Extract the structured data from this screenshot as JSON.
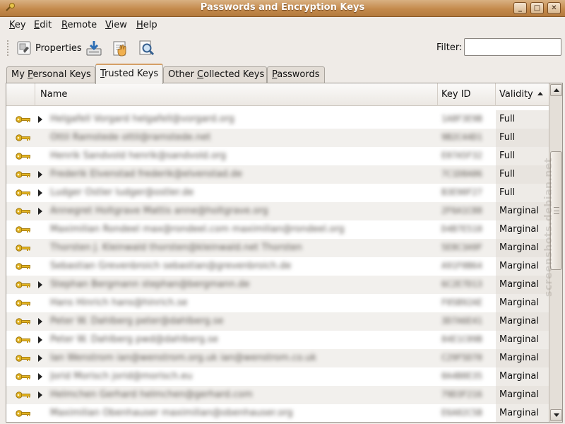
{
  "window": {
    "title": "Passwords and Encryption Keys",
    "controls": [
      "_",
      "□",
      "✕"
    ]
  },
  "menubar": {
    "items": [
      {
        "pre": "",
        "u": "K",
        "post": "ey"
      },
      {
        "pre": "",
        "u": "E",
        "post": "dit"
      },
      {
        "pre": "",
        "u": "R",
        "post": "emote"
      },
      {
        "pre": "",
        "u": "V",
        "post": "iew"
      },
      {
        "pre": "",
        "u": "H",
        "post": "elp"
      }
    ]
  },
  "toolbar": {
    "properties_label": "Properties",
    "icons": [
      "properties-icon",
      "import-icon",
      "sign-icon",
      "search-remote-icon"
    ],
    "filter_label": "Filter:",
    "filter_value": ""
  },
  "tabs": [
    {
      "pre": "My ",
      "u": "P",
      "post": "ersonal Keys",
      "active": false
    },
    {
      "pre": "",
      "u": "T",
      "post": "rusted Keys",
      "active": true
    },
    {
      "pre": "Other ",
      "u": "C",
      "post": "ollected Keys",
      "active": false
    },
    {
      "pre": "",
      "u": "P",
      "post": "asswords",
      "active": false
    }
  ],
  "table": {
    "columns": {
      "name": "Name",
      "keyid": "Key ID",
      "validity": "Validity"
    },
    "sort": "validity-ascending",
    "rows": [
      {
        "expander": true,
        "name": "Helgafell Vorgard  helgafell@vorgard.org",
        "keyid": "1A8F3E9B",
        "validity": "Full"
      },
      {
        "expander": false,
        "name": "Ottil Ramstede  ottil@ramstede.net",
        "keyid": "9B2C44D1",
        "validity": "Full"
      },
      {
        "expander": false,
        "name": "Henrik Sandvold  henrik@sandvold.org",
        "keyid": "E07A5F32",
        "validity": "Full"
      },
      {
        "expander": true,
        "name": "Frederik Elvenstad  frederik@elvenstad.de",
        "keyid": "7C1D8A06",
        "validity": "Full"
      },
      {
        "expander": true,
        "name": "Ludger Ostler  ludger@ostler.de",
        "keyid": "B3E90F27",
        "validity": "Full"
      },
      {
        "expander": true,
        "name": "Annegret Holtgrave Mattis  anne@holtgrave.org",
        "keyid": "2F6A1C88",
        "validity": "Marginal"
      },
      {
        "expander": false,
        "name": "Maximilian Rondeel  max@rondeel.com  maximilian@rondeel.org",
        "keyid": "D4B7E510",
        "validity": "Marginal"
      },
      {
        "expander": false,
        "name": "Thorsten J. Kleinwald  thorsten@kleinwald.net  Thorsten",
        "keyid": "5E8C3A9F",
        "validity": "Marginal"
      },
      {
        "expander": false,
        "name": "Sebastian Grevenbroich  sebastian@grevenbroich.de",
        "keyid": "A91F0B64",
        "validity": "Marginal"
      },
      {
        "expander": true,
        "name": "Stephan Bergmann  stephan@bergmann.de",
        "keyid": "6C2E7D13",
        "validity": "Marginal"
      },
      {
        "expander": false,
        "name": "Hans Hinrich  hans@hinrich.se",
        "keyid": "F05B92AE",
        "validity": "Marginal"
      },
      {
        "expander": true,
        "name": "Peter W. Dahlberg  peter@dahlberg.se",
        "keyid": "3D7A6E41",
        "validity": "Marginal"
      },
      {
        "expander": true,
        "name": "Peter W. Dahlberg  pwd@dahlberg.se",
        "keyid": "84E1C09B",
        "validity": "Marginal"
      },
      {
        "expander": true,
        "name": "Ian Wenstrom  ian@wenstrom.org.uk  ian@wenstrom.co.uk",
        "keyid": "C29F5D70",
        "validity": "Marginal"
      },
      {
        "expander": true,
        "name": "Jorid Morisch  jorid@morisch.eu",
        "keyid": "0A4B8E35",
        "validity": "Marginal"
      },
      {
        "expander": true,
        "name": "Helmchen Gerhard  helmchen@gerhard.com",
        "keyid": "79D3F216",
        "validity": "Marginal"
      },
      {
        "expander": false,
        "name": "Maximilian Obenhauser  maximilian@obenhauser.org",
        "keyid": "E6A02C5B",
        "validity": "Marginal"
      }
    ]
  },
  "watermark": "screenshots.debian.net",
  "colors": {
    "titlebar": "#c48a4c",
    "active_tab_accent": "#d59f66",
    "key_icon": "#d9a316",
    "row_alt": "#f2f0ed"
  }
}
